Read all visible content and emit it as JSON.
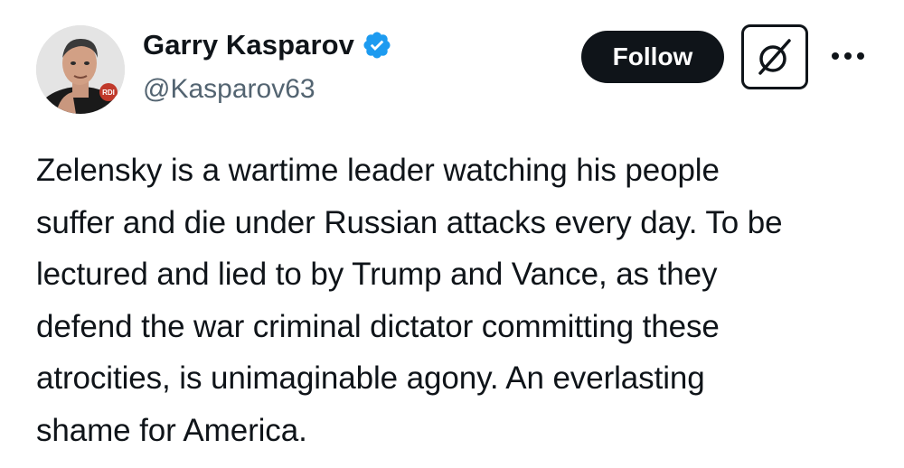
{
  "author": {
    "display_name": "Garry Kasparov",
    "handle": "@Kasparov63",
    "verified_badge_color": "#1d9bf0",
    "avatar_badge_text": "RDI"
  },
  "actions": {
    "follow_label": "Follow",
    "grok_icon": "grok-icon",
    "more_icon": "more-icon"
  },
  "tweet": {
    "text": "Zelensky is a wartime leader watching his people\nsuffer and die under Russian attacks every day. To be\nlectured and lied to by Trump and Vance, as they\ndefend the war criminal dictator committing these\natrocities, is unimaginable agony. An everlasting\nshame for America."
  }
}
